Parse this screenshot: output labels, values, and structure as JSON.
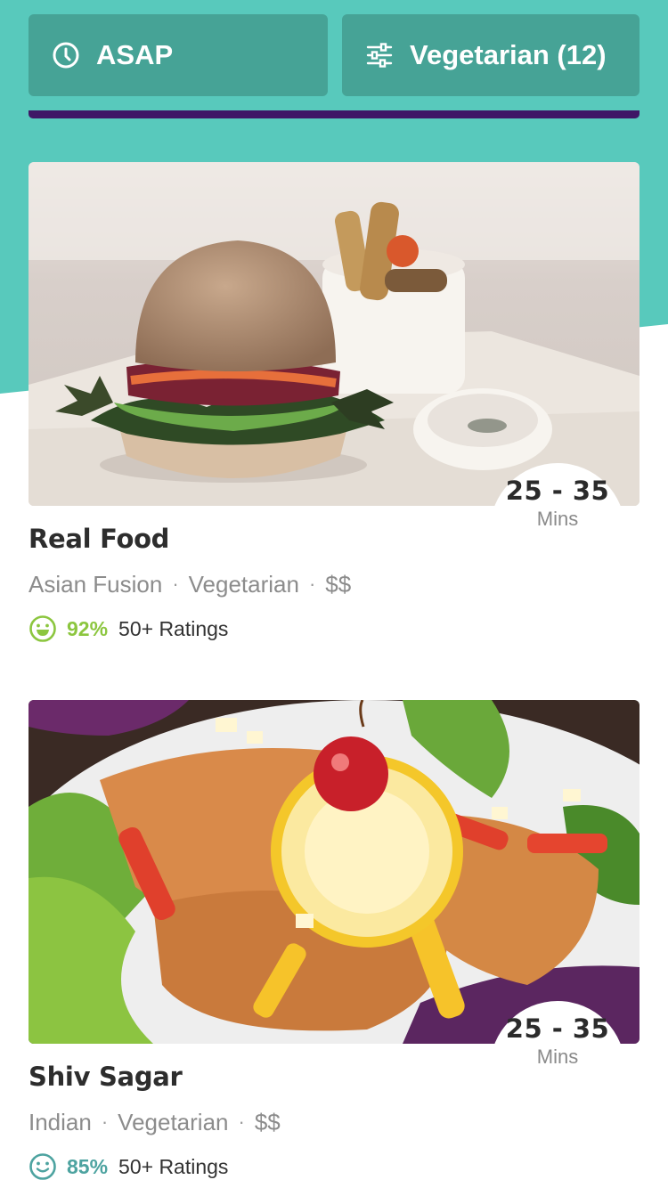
{
  "colors": {
    "teal": "#58C9BC",
    "button": "#46A396",
    "purple": "#3F1766",
    "rating_green": "#8CC63F",
    "rating_teal": "#4DA3A0"
  },
  "filters": {
    "asap": {
      "icon": "clock-icon",
      "label": "ASAP"
    },
    "diet": {
      "icon": "sliders-icon",
      "label": "Vegetarian (12)"
    }
  },
  "restaurants": [
    {
      "name": "Real Food",
      "eta_range": "25 - 35",
      "eta_unit": "Mins",
      "cuisine": "Asian Fusion",
      "diet": "Vegetarian",
      "price": "$$",
      "rating_pct": "92%",
      "rating_count": "50+ Ratings",
      "rating_icon": "big-smile-icon"
    },
    {
      "name": "Shiv Sagar",
      "eta_range": "25 - 35",
      "eta_unit": "Mins",
      "cuisine": "Indian",
      "diet": "Vegetarian",
      "price": "$$",
      "rating_pct": "85%",
      "rating_count": "50+ Ratings",
      "rating_icon": "smile-icon"
    }
  ]
}
